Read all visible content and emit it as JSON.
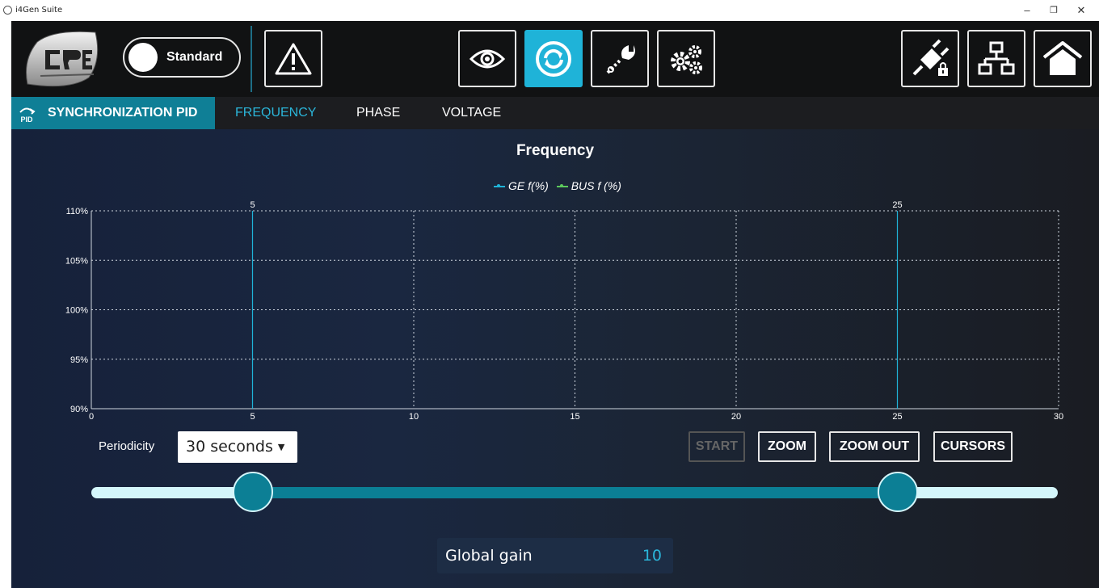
{
  "window": {
    "title": "i4Gen Suite",
    "minimize": "–",
    "restore": "❐",
    "close": "✕"
  },
  "toolbar": {
    "mode_label": "Standard",
    "buttons": [
      {
        "name": "alarm",
        "icon": "warning-icon"
      },
      {
        "name": "monitor",
        "icon": "eye-icon"
      },
      {
        "name": "sync",
        "icon": "sync-icon",
        "active": true
      },
      {
        "name": "tools",
        "icon": "wrench-icon"
      },
      {
        "name": "settings",
        "icon": "gears-icon"
      },
      {
        "name": "connect",
        "icon": "plug-lock-icon"
      },
      {
        "name": "network",
        "icon": "network-icon"
      },
      {
        "name": "home",
        "icon": "home-icon"
      }
    ],
    "accent": "#1fb3d8"
  },
  "subnav": {
    "title": "SYNCHRONIZATION PID",
    "icon_text": "PID",
    "tabs": [
      {
        "label": "FREQUENCY",
        "active": true
      },
      {
        "label": "PHASE",
        "active": false
      },
      {
        "label": "VOLTAGE",
        "active": false
      }
    ]
  },
  "chart_data": {
    "type": "line",
    "title": "Frequency",
    "series": [
      {
        "name": "GE f(%)",
        "color": "#1fb3d8",
        "values": []
      },
      {
        "name": "BUS f (%)",
        "color": "#5cc85c",
        "values": []
      }
    ],
    "xlim": [
      0,
      30
    ],
    "ylim": [
      90,
      110
    ],
    "x_ticks": [
      "0",
      "5",
      "10",
      "15",
      "20",
      "25",
      "30"
    ],
    "y_ticks": [
      "90%",
      "95%",
      "100%",
      "105%",
      "110%"
    ],
    "cursors": [
      5,
      25
    ],
    "grid": true,
    "legend": "top"
  },
  "controls": {
    "periodicity_label": "Periodicity",
    "periodicity_value": "30 seconds",
    "periodicity_arrow": "▼",
    "start": "START",
    "zoom": "ZOOM",
    "zoom_out": "ZOOM OUT",
    "cursors": "CURSORS",
    "range_slider": [
      5,
      25
    ]
  },
  "gain": {
    "label": "Global gain",
    "value": "10"
  }
}
